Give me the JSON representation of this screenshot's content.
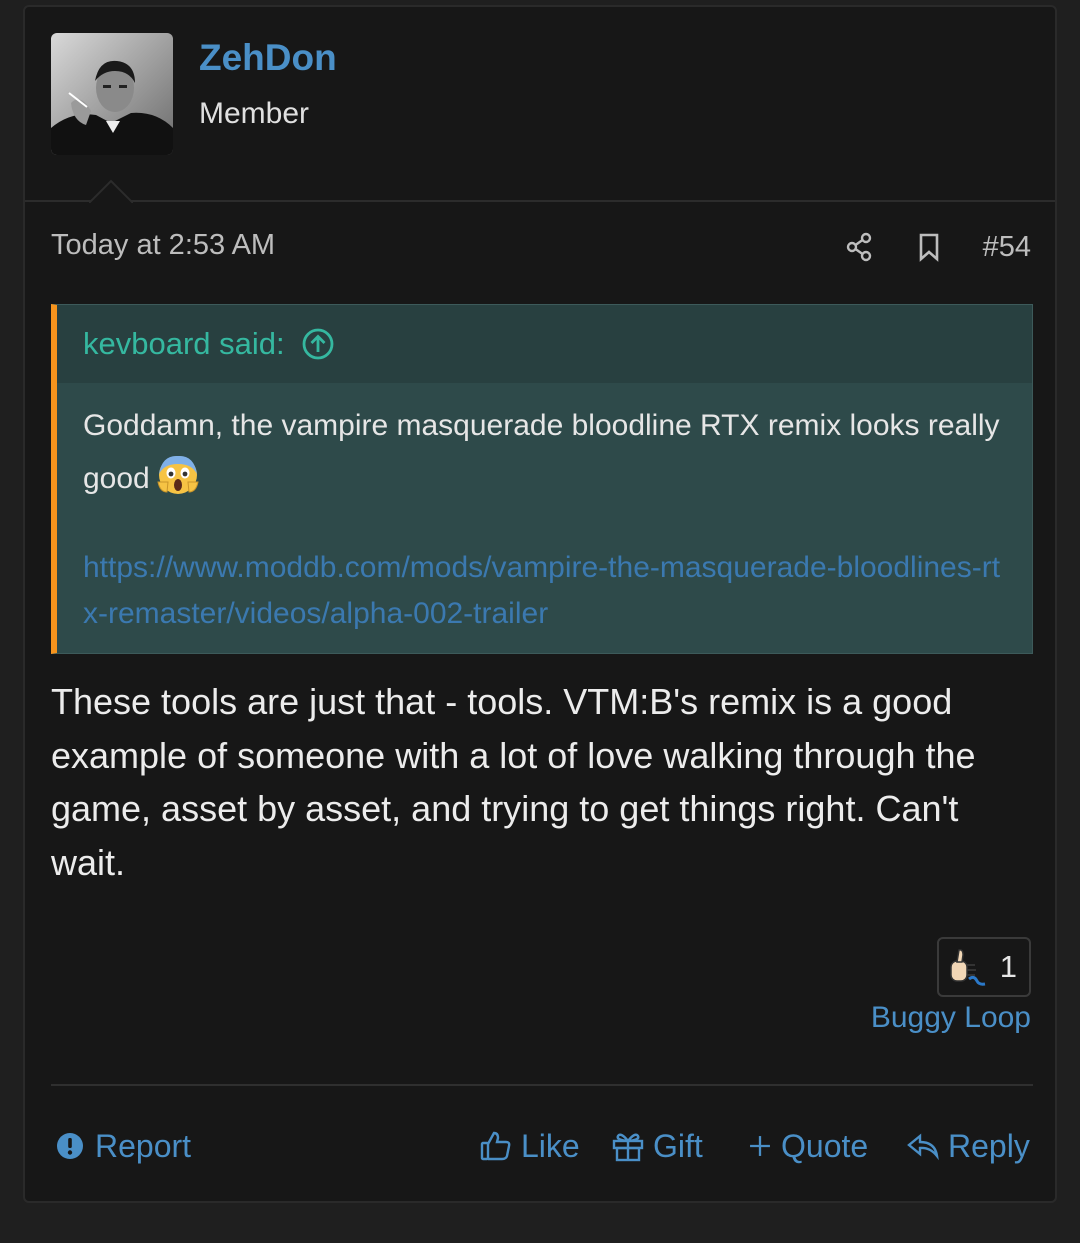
{
  "user": {
    "name": "ZehDon",
    "title": "Member"
  },
  "meta": {
    "date": "Today at 2:53 AM",
    "post_number": "#54",
    "share_icon": "share-icon",
    "bookmark_icon": "bookmark-icon"
  },
  "quote": {
    "author": "kevboard said:",
    "text": "Goddamn, the vampire masquerade bloodline RTX remix looks really good",
    "emoji": "face-screaming-in-fear",
    "link": "https://www.moddb.com/mods/vampire-the-masquerade-bloodlines-rtx-remaster/videos/alpha-002-trailer"
  },
  "message": "These tools are just that - tools. VTM:B's remix is a good example of someone with a lot of love walking through the game, asset by asset, and trying to get things right. Can't wait.",
  "reactions": {
    "icon": "thumbs-up-reaction-icon",
    "count": "1",
    "users": "Buggy Loop"
  },
  "footer": {
    "report": "Report",
    "like": "Like",
    "gift": "Gift",
    "quote": "Quote",
    "reply": "Reply"
  },
  "colors": {
    "link": "#4a8fc7",
    "quote_bg": "#2e4a4a",
    "quote_accent": "#f7941d",
    "quote_author": "#35b8a0",
    "background": "#171717"
  }
}
